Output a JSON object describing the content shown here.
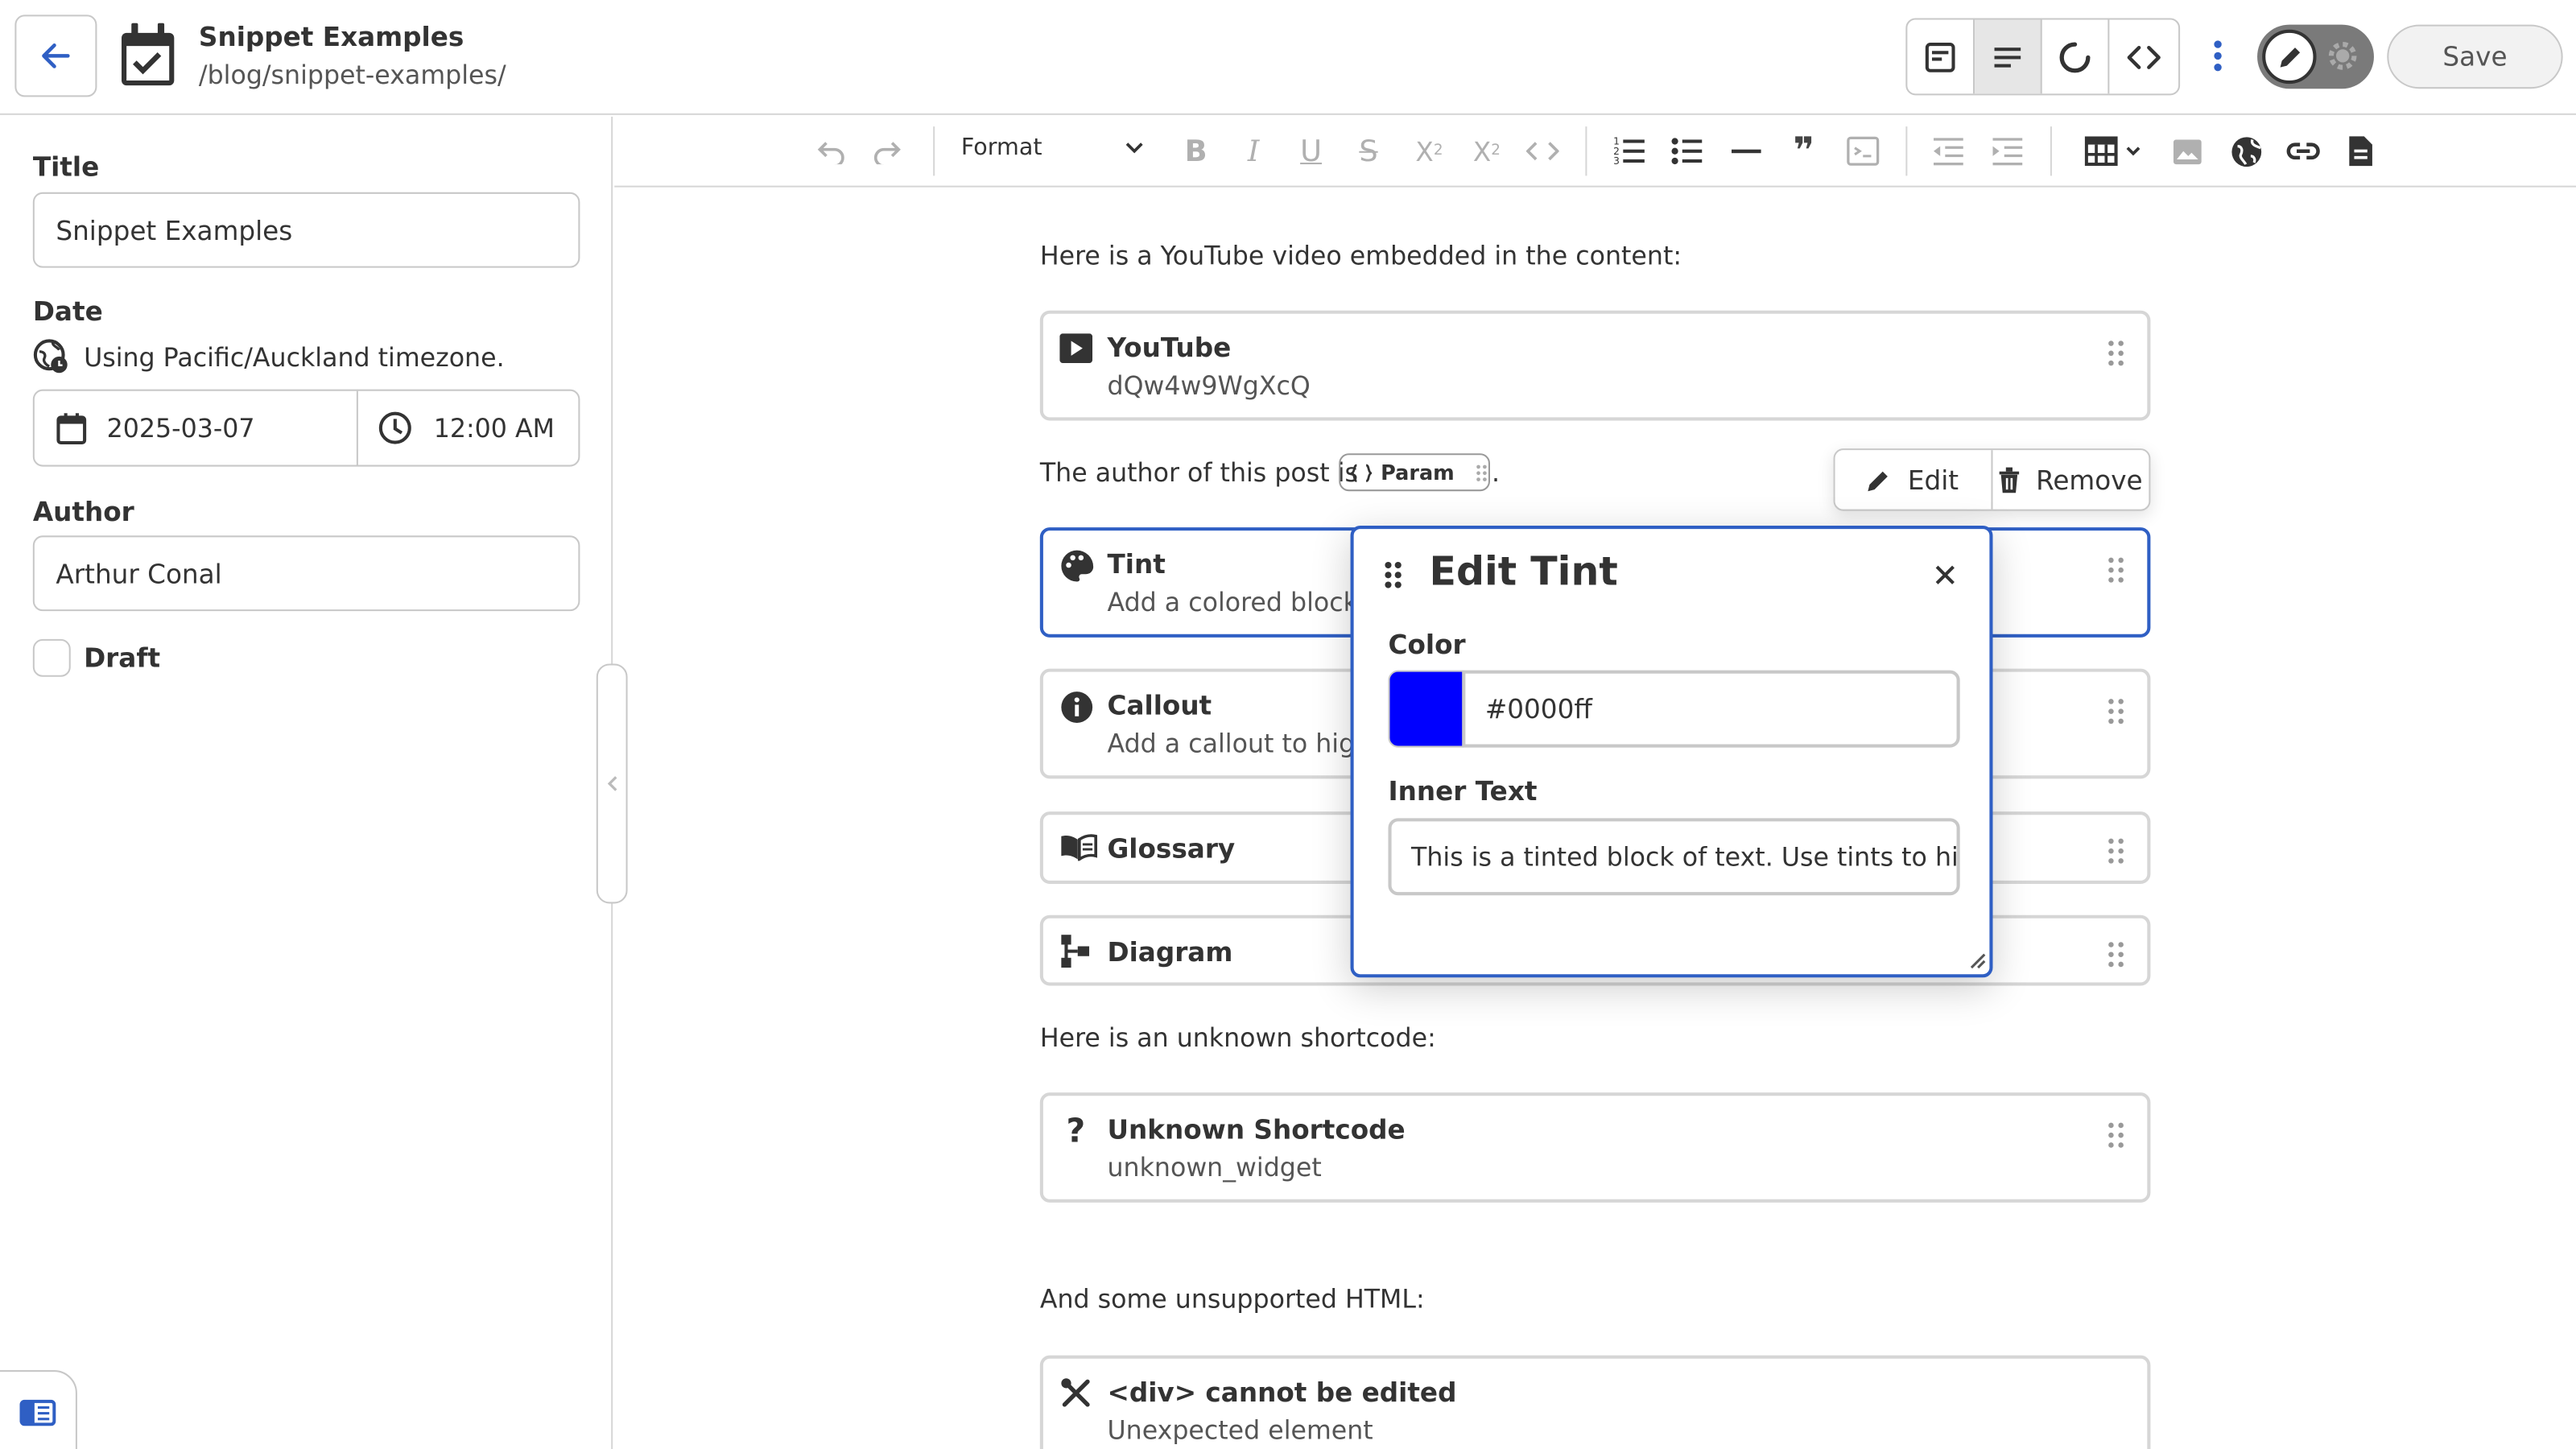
{
  "header": {
    "title": "Snippet Examples",
    "path": "/blog/snippet-examples/",
    "save_label": "Save"
  },
  "sidebar": {
    "title_label": "Title",
    "title_value": "Snippet Examples",
    "date_label": "Date",
    "timezone_note": "Using Pacific/Auckland timezone.",
    "date_value": "2025-03-07",
    "time_value": "12:00 AM",
    "author_label": "Author",
    "author_value": "Arthur Conal",
    "draft_label": "Draft",
    "draft_checked": false
  },
  "toolbar": {
    "format_label": "Format"
  },
  "content": {
    "para_youtube": "Here is a YouTube video embedded in the content:",
    "youtube_title": "YouTube",
    "youtube_sub": "dQw4w9WgXcQ",
    "para_author": "The author of this post is",
    "para_author_end": ".",
    "param_label": "Param",
    "edit_label": "Edit",
    "remove_label": "Remove",
    "tint_title": "Tint",
    "tint_sub": "Add a colored block o",
    "callout_title": "Callout",
    "callout_sub": "Add a callout to high",
    "glossary_title": "Glossary",
    "diagram_title": "Diagram",
    "para_unknown": "Here is an unknown shortcode:",
    "unknown_title": "Unknown Shortcode",
    "unknown_sub": "unknown_widget",
    "para_html": "And some unsupported HTML:",
    "div_title": "<div> cannot be edited",
    "div_sub": "Unexpected element"
  },
  "dialog": {
    "title": "Edit Tint",
    "color_label": "Color",
    "color_value": "#0000ff",
    "inner_label": "Inner Text",
    "inner_value": "This is a tinted block of text. Use tints to highl"
  },
  "colors": {
    "accent": "#2f5fc4",
    "swatch": "#0000ff"
  }
}
